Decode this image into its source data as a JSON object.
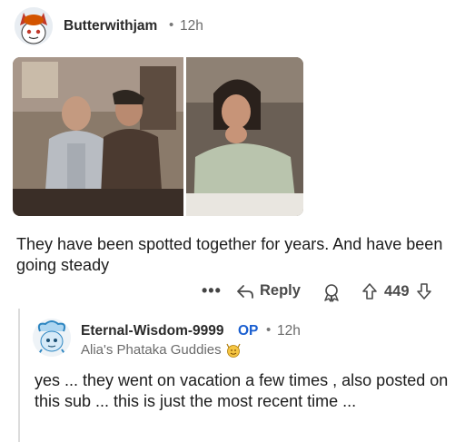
{
  "comment": {
    "username": "Butterwithjam",
    "separator": "•",
    "time": "12h",
    "body": "They have been spotted together for years. And have been going steady",
    "actions": {
      "more": "•••",
      "reply_label": "Reply",
      "vote_count": "449"
    }
  },
  "reply": {
    "username": "Eternal-Wisdom-9999",
    "op_badge": "OP",
    "separator": "•",
    "time": "12h",
    "flair": "Alia's Phataka Guddies",
    "body": "yes ... they went on vacation a few times , also posted on this sub ... this is just the most recent time ..."
  },
  "colors": {
    "op_blue": "#1a5fd0",
    "muted_text": "#6b6b6b",
    "thread_line": "#dcdcdc"
  }
}
